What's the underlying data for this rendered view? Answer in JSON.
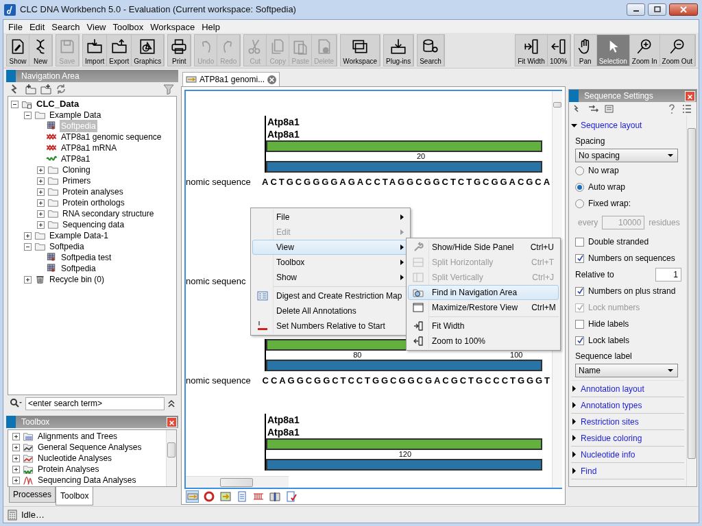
{
  "window": {
    "title": "CLC DNA Workbench 5.0 - Evaluation  (Current workspace: Softpedia)"
  },
  "menu_bar": [
    "File",
    "Edit",
    "Search",
    "View",
    "Toolbox",
    "Workspace",
    "Help"
  ],
  "toolbar": {
    "groups": [
      {
        "buttons": [
          {
            "label": "Show",
            "disabled": false
          },
          {
            "label": "New",
            "disabled": false
          }
        ]
      },
      {
        "buttons": [
          {
            "label": "Save",
            "disabled": true
          }
        ]
      },
      {
        "buttons": [
          {
            "label": "Import",
            "disabled": false
          },
          {
            "label": "Export",
            "disabled": false
          },
          {
            "label": "Graphics",
            "disabled": false
          }
        ]
      },
      {
        "buttons": [
          {
            "label": "Print",
            "disabled": false
          }
        ]
      },
      {
        "buttons": [
          {
            "label": "Undo",
            "disabled": true
          },
          {
            "label": "Redo",
            "disabled": true
          }
        ]
      },
      {
        "buttons": [
          {
            "label": "Cut",
            "disabled": true
          },
          {
            "label": "Copy",
            "disabled": true
          },
          {
            "label": "Paste",
            "disabled": true
          },
          {
            "label": "Delete",
            "disabled": true
          }
        ]
      },
      {
        "buttons": [
          {
            "label": "Workspace",
            "disabled": false
          }
        ]
      },
      {
        "buttons": [
          {
            "label": "Plug-ins",
            "disabled": false
          }
        ]
      },
      {
        "buttons": [
          {
            "label": "Search",
            "disabled": false
          }
        ]
      }
    ],
    "right_groups": [
      {
        "buttons": [
          {
            "label": "Fit Width",
            "disabled": false
          },
          {
            "label": "100%",
            "disabled": false
          }
        ]
      },
      {
        "buttons": [
          {
            "label": "Pan",
            "disabled": false,
            "selected": false
          },
          {
            "label": "Selection",
            "disabled": false,
            "selected": true
          },
          {
            "label": "Zoom In",
            "disabled": false,
            "selected": false
          },
          {
            "label": "Zoom Out",
            "disabled": false,
            "selected": false
          }
        ]
      }
    ]
  },
  "navigation": {
    "title": "Navigation Area",
    "search": {
      "placeholder": "<enter search term>"
    },
    "tree": [
      {
        "label": "CLC_Data",
        "kind": "root",
        "expanded": true,
        "selected": false,
        "children": [
          {
            "label": "Example Data",
            "kind": "folder",
            "expanded": true,
            "selected": false,
            "children": [
              {
                "label": "Softpedia",
                "kind": "map",
                "selected": true
              },
              {
                "label": "ATP8a1 genomic sequence",
                "kind": "dna",
                "selected": false
              },
              {
                "label": "ATP8a1 mRNA",
                "kind": "dna",
                "selected": false
              },
              {
                "label": "ATP8a1",
                "kind": "protein",
                "selected": false
              },
              {
                "label": "Cloning",
                "kind": "folder",
                "expanded": false,
                "selected": false
              },
              {
                "label": "Primers",
                "kind": "folder",
                "expanded": false,
                "selected": false
              },
              {
                "label": "Protein analyses",
                "kind": "folder",
                "expanded": false,
                "selected": false
              },
              {
                "label": "Protein orthologs",
                "kind": "folder",
                "expanded": false,
                "selected": false
              },
              {
                "label": "RNA secondary structure",
                "kind": "folder",
                "expanded": false,
                "selected": false
              },
              {
                "label": "Sequencing data",
                "kind": "folder",
                "expanded": false,
                "selected": false
              }
            ]
          },
          {
            "label": "Example Data-1",
            "kind": "folder",
            "expanded": false,
            "selected": false
          },
          {
            "label": "Softpedia",
            "kind": "folder",
            "expanded": true,
            "selected": false,
            "children": [
              {
                "label": "Softpedia test",
                "kind": "map",
                "selected": false
              },
              {
                "label": "Softpedia",
                "kind": "map",
                "selected": false
              }
            ]
          },
          {
            "label": "Recycle bin (0)",
            "kind": "trash",
            "expanded": false,
            "selected": false
          }
        ]
      }
    ]
  },
  "toolbox": {
    "title": "Toolbox",
    "items": [
      {
        "label": "Alignments and Trees",
        "expanded": false
      },
      {
        "label": "General Sequence Analyses",
        "expanded": false
      },
      {
        "label": "Nucleotide Analyses",
        "expanded": false
      },
      {
        "label": "Protein Analyses",
        "expanded": false
      },
      {
        "label": "Sequencing Data Analyses",
        "expanded": false
      }
    ],
    "tabs": [
      {
        "label": "Processes",
        "selected": false
      },
      {
        "label": "Toolbox",
        "selected": true
      }
    ]
  },
  "editor": {
    "tab": {
      "label": "ATP8a1 genomi..."
    },
    "blocks": [
      {
        "labels": [
          "Atp8a1",
          "Atp8a1"
        ],
        "bars": true,
        "ruler": [
          "20"
        ],
        "name": "nomic sequence",
        "sequence": "ACTGCGGGGAGACCTAGGCGGCTCTGCGGACGCA"
      },
      {
        "bars": false,
        "name": "nomic sequenc"
      },
      {
        "bars": true,
        "ruler": [
          "80",
          "100"
        ],
        "name": "nomic sequence",
        "sequence": "CCAGGCGGCTCCTGGCGGCGACGCTGCCCTGGGT"
      },
      {
        "labels": [
          "Atp8a1",
          "Atp8a1"
        ],
        "bars": true,
        "ruler": [
          "120"
        ]
      }
    ],
    "view_buttons": [
      {
        "selected": true
      },
      {
        "selected": false
      },
      {
        "selected": false
      },
      {
        "selected": false
      },
      {
        "selected": false
      },
      {
        "selected": false
      },
      {
        "selected": false
      }
    ]
  },
  "context_menu": {
    "items": [
      {
        "kind": "item",
        "label": "File",
        "disabled": false,
        "submenu": true,
        "selected": false
      },
      {
        "kind": "item",
        "label": "Edit",
        "disabled": true,
        "submenu": true,
        "selected": false
      },
      {
        "kind": "item",
        "label": "View",
        "disabled": false,
        "submenu": true,
        "selected": true
      },
      {
        "kind": "item",
        "label": "Toolbox",
        "disabled": false,
        "submenu": true,
        "selected": false
      },
      {
        "kind": "item",
        "label": "Show",
        "disabled": false,
        "submenu": true,
        "selected": false
      },
      {
        "kind": "separator"
      },
      {
        "kind": "item",
        "label": "Digest and Create Restriction Map",
        "disabled": false,
        "submenu": false,
        "selected": false
      },
      {
        "kind": "item",
        "label": "Delete All Annotations",
        "disabled": false,
        "submenu": false,
        "selected": false
      },
      {
        "kind": "item",
        "label": "Set Numbers Relative to Start",
        "disabled": false,
        "submenu": false,
        "selected": false
      }
    ],
    "submenu": [
      {
        "kind": "item",
        "label": "Show/Hide Side Panel",
        "shortcut": "Ctrl+U",
        "disabled": false,
        "selected": false
      },
      {
        "kind": "item",
        "label": "Split Horizontally",
        "shortcut": "Ctrl+T",
        "disabled": true,
        "selected": false
      },
      {
        "kind": "item",
        "label": "Split Vertically",
        "shortcut": "Ctrl+J",
        "disabled": true,
        "selected": false
      },
      {
        "kind": "item",
        "label": "Find in Navigation Area",
        "disabled": false,
        "selected": true
      },
      {
        "kind": "item",
        "label": "Maximize/Restore View",
        "shortcut": "Ctrl+M",
        "disabled": false,
        "selected": false
      },
      {
        "kind": "separator"
      },
      {
        "kind": "item",
        "label": "Fit Width",
        "disabled": false,
        "selected": false
      },
      {
        "kind": "item",
        "label": "Zoom to 100%",
        "disabled": false,
        "selected": false
      }
    ]
  },
  "sequence_settings": {
    "title": "Sequence Settings",
    "sections": [
      {
        "title": "Sequence layout",
        "expanded": true,
        "controls": [
          {
            "kind": "label",
            "text": "Spacing"
          },
          {
            "kind": "select",
            "value": "No spacing"
          },
          {
            "kind": "radio",
            "label": "No wrap",
            "selected": false
          },
          {
            "kind": "radio",
            "label": "Auto wrap",
            "selected": true
          },
          {
            "kind": "radio",
            "label": "Fixed wrap:",
            "selected": false
          },
          {
            "kind": "inline-field",
            "prefix": "every",
            "value": "10000",
            "suffix": "residues",
            "disabled": true
          },
          {
            "kind": "checkbox",
            "label": "Double stranded",
            "checked": false,
            "disabled": false
          },
          {
            "kind": "checkbox",
            "label": "Numbers on sequences",
            "checked": true,
            "disabled": false
          },
          {
            "kind": "labeled-field",
            "label": "Relative to",
            "value": "1"
          },
          {
            "kind": "checkbox",
            "label": "Numbers on plus strand",
            "checked": true,
            "disabled": false
          },
          {
            "kind": "checkbox",
            "label": "Lock numbers",
            "checked": true,
            "disabled": true
          },
          {
            "kind": "checkbox",
            "label": "Hide labels",
            "checked": false,
            "disabled": false
          },
          {
            "kind": "checkbox",
            "label": "Lock labels",
            "checked": true,
            "disabled": false
          },
          {
            "kind": "label",
            "text": "Sequence label"
          },
          {
            "kind": "select",
            "value": "Name"
          }
        ]
      },
      {
        "title": "Annotation layout",
        "expanded": false
      },
      {
        "title": "Annotation types",
        "expanded": false
      },
      {
        "title": "Restriction sites",
        "expanded": false
      },
      {
        "title": "Residue coloring",
        "expanded": false
      },
      {
        "title": "Nucleotide info",
        "expanded": false
      },
      {
        "title": "Find",
        "expanded": false
      }
    ]
  },
  "status_bar": {
    "text": "Idle…"
  }
}
